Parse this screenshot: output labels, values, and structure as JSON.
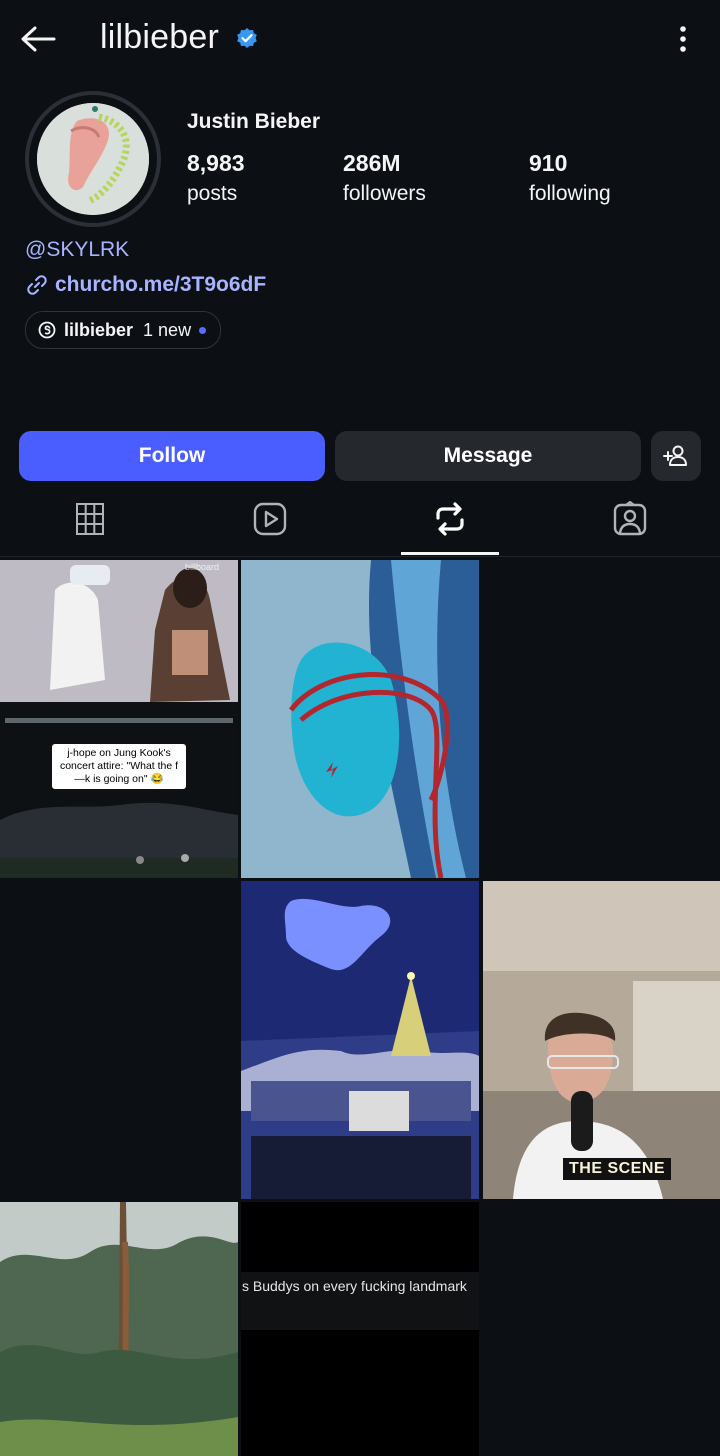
{
  "header": {
    "username": "lilbieber",
    "back_icon": "arrow-left-icon",
    "verified_icon": "verified-badge-icon",
    "more_icon": "more-vertical-icon"
  },
  "profile": {
    "full_name": "Justin Bieber",
    "stats": [
      {
        "value": "8,983",
        "label": "posts"
      },
      {
        "value": "286M",
        "label": "followers"
      },
      {
        "value": "910",
        "label": "following"
      }
    ],
    "threads_handle": "@SKYLRK",
    "link": "churcho.me/3T9o6dF",
    "threads_pill": {
      "name": "lilbieber",
      "badge": "1 new"
    }
  },
  "actions": {
    "follow": "Follow",
    "message": "Message",
    "add_user_icon": "add-user-icon"
  },
  "tabs": [
    {
      "name": "grid-icon",
      "active": false
    },
    {
      "name": "reels-icon",
      "active": false
    },
    {
      "name": "reposts-icon",
      "active": true
    },
    {
      "name": "tagged-icon",
      "active": false
    }
  ],
  "grid": {
    "post1_caption": "j-hope on Jung Kook's concert attire: \"What the f—k is going on\" 😂",
    "post1_watermark": "billboard",
    "post5_label": "THE SCENE",
    "post7_caption": "s Buddys on every fucking landmark"
  },
  "colors": {
    "background": "#0c1014",
    "accent": "#4a5dff",
    "link": "#a8b4ff",
    "secondary_button": "#25292e"
  }
}
